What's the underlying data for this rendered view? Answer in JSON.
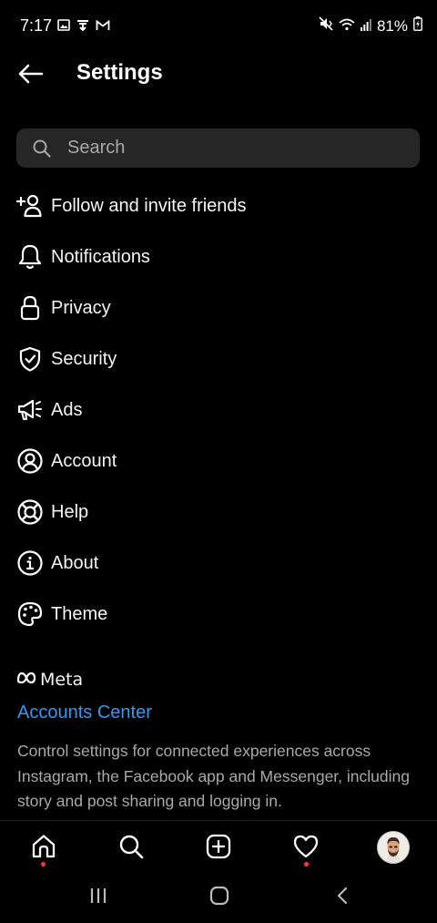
{
  "status_bar": {
    "time": "7:17",
    "battery": "81%",
    "left_icons": [
      "gallery-icon",
      "cloud-download-icon",
      "gmail-icon"
    ],
    "right_icons": [
      "mute-vibrate-icon",
      "wifi-icon",
      "signal-icon",
      "battery-charging-icon"
    ]
  },
  "header": {
    "title": "Settings",
    "back_icon": "arrow-left-icon"
  },
  "search": {
    "placeholder": "Search"
  },
  "menu": {
    "items": [
      {
        "label": "Follow and invite friends",
        "icon": "add-person-icon"
      },
      {
        "label": "Notifications",
        "icon": "bell-icon"
      },
      {
        "label": "Privacy",
        "icon": "lock-icon"
      },
      {
        "label": "Security",
        "icon": "shield-check-icon"
      },
      {
        "label": "Ads",
        "icon": "megaphone-icon"
      },
      {
        "label": "Account",
        "icon": "user-circle-icon"
      },
      {
        "label": "Help",
        "icon": "lifebuoy-icon"
      },
      {
        "label": "About",
        "icon": "info-icon"
      },
      {
        "label": "Theme",
        "icon": "palette-icon"
      }
    ]
  },
  "meta": {
    "logo_text": "Meta",
    "accounts_center": "Accounts Center",
    "description": "Control settings for connected experiences across Instagram, the Facebook app and Messenger, including story and post sharing and logging in."
  },
  "bottom_nav": {
    "items": [
      "home-icon",
      "search-icon",
      "create-icon",
      "activity-heart-icon",
      "profile-avatar"
    ],
    "notification_dot_color": "#ff3040"
  },
  "colors": {
    "background": "#000000",
    "search_bg": "#262626",
    "link": "#3797f0",
    "secondary_text": "#a8a8a8"
  }
}
